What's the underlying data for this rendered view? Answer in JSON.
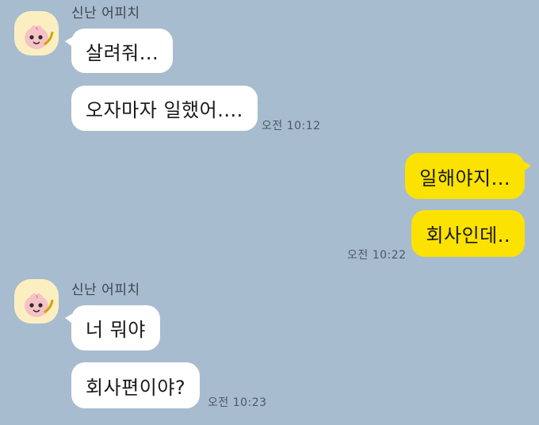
{
  "colors": {
    "background": "#a8bccf",
    "incoming_bubble": "#ffffff",
    "outgoing_bubble": "#fbe200",
    "avatar_bg": "#fbefc2"
  },
  "groups": [
    {
      "sender": "신난 어피치",
      "avatar_icon": "apeach-character-icon",
      "messages": [
        "살려줘...",
        "오자마자 일했어...."
      ],
      "time": "오전 10:12"
    },
    {
      "sender": "me",
      "messages": [
        "일해야지...",
        "회사인데.."
      ],
      "time": "오전 10:22"
    },
    {
      "sender": "신난 어피치",
      "avatar_icon": "apeach-character-icon",
      "messages": [
        "너 뭐야",
        "회사편이야?"
      ],
      "time": "오전 10:23"
    }
  ]
}
